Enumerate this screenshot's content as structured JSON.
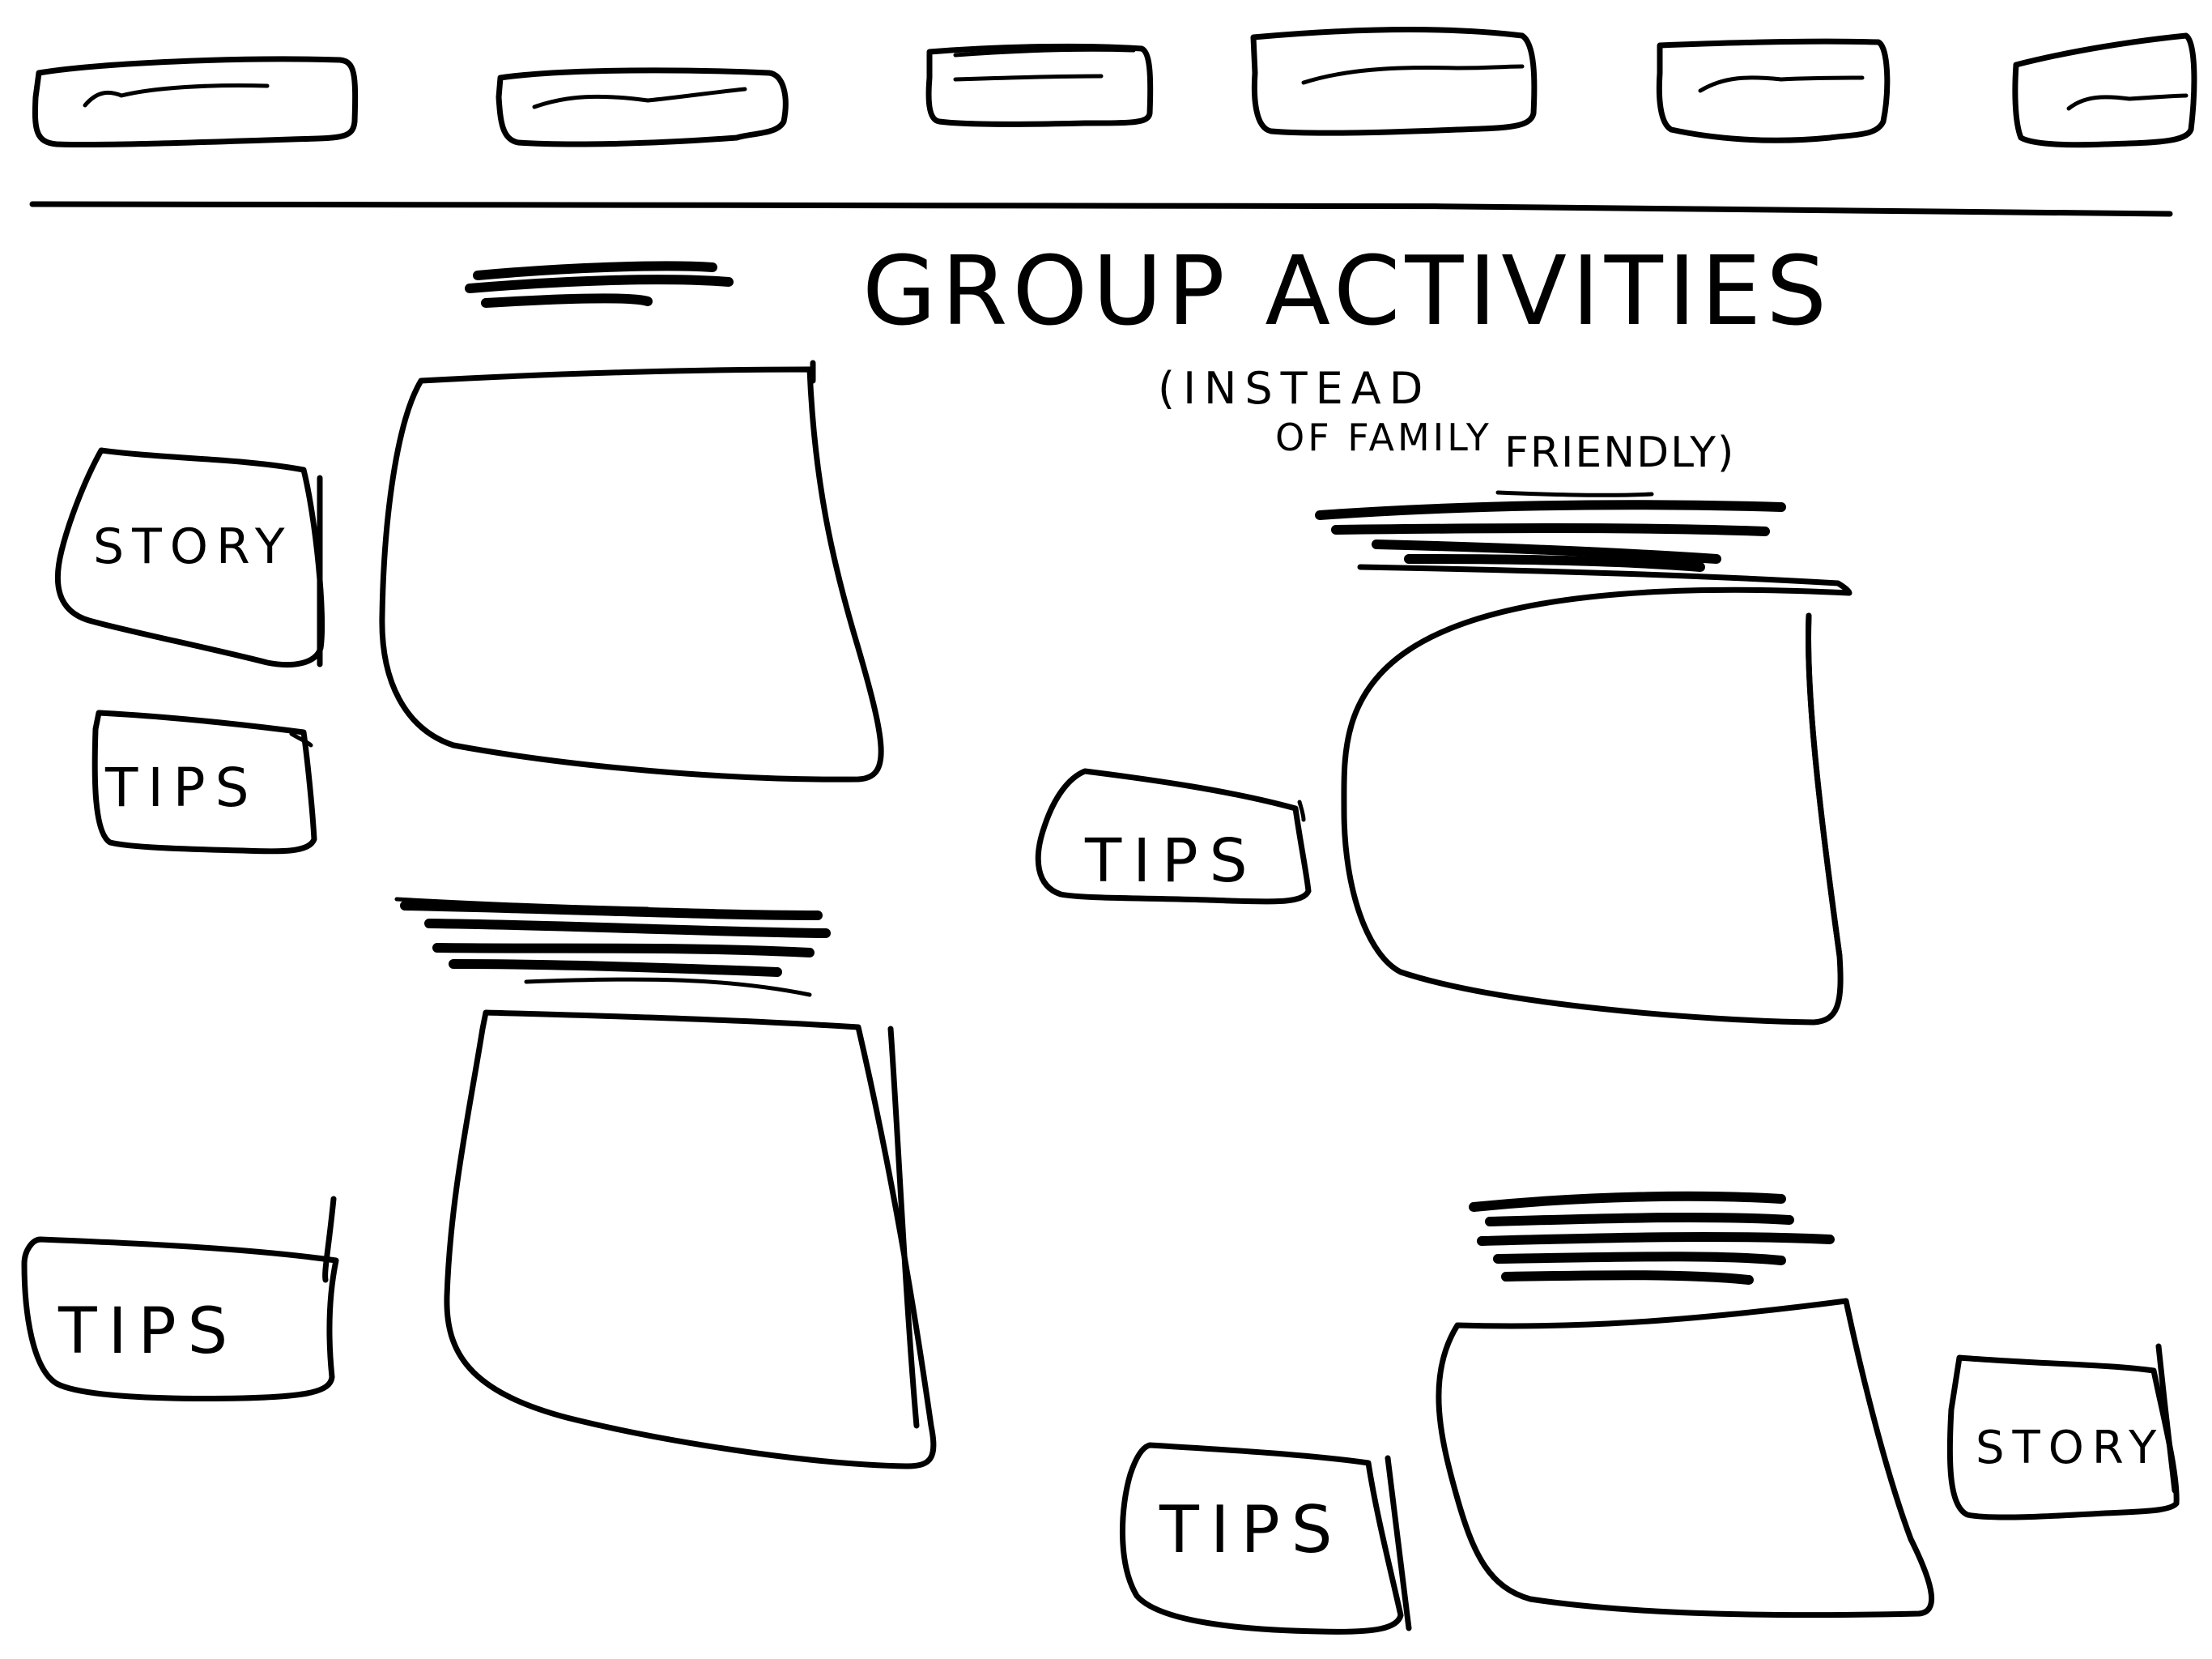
{
  "header": {
    "title": "GROUP ACTIVITIES",
    "subtitle_line1": "(INSTEAD",
    "subtitle_line2": "OF FAMILY",
    "subtitle_line3": "FRIENDLY)"
  },
  "nav": {
    "tab_count": 6
  },
  "sections": {
    "top_left": {
      "story_label": "STORY",
      "tips_label": "TIPS"
    },
    "bottom_left": {
      "tips_label": "TIPS"
    },
    "right_middle": {
      "tips_label": "TIPS"
    },
    "bottom_right": {
      "tips_label": "TIPS",
      "story_label": "STORY"
    }
  },
  "colors": {
    "ink": "#000000",
    "paper": "#ffffff"
  }
}
